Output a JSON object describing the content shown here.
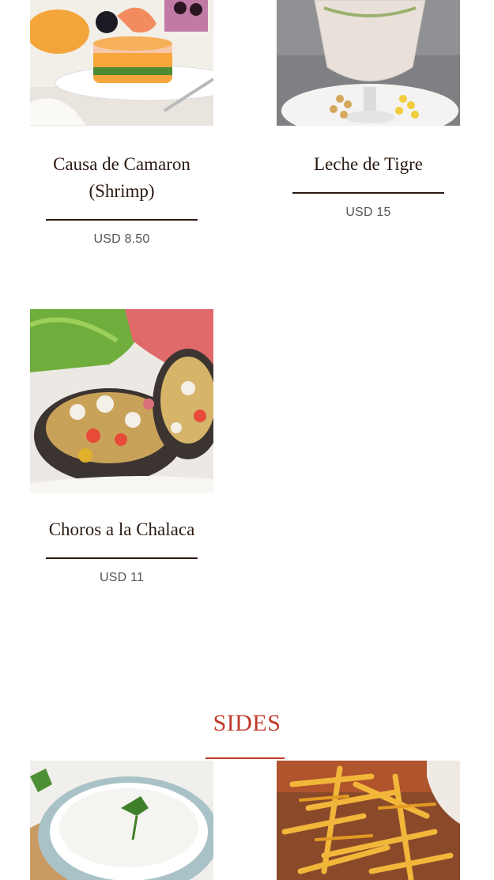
{
  "menu": {
    "items": [
      {
        "name": "Causa de Camaron (Shrimp)",
        "name_line1": "Causa de Camaron",
        "name_line2": "(Shrimp)",
        "price": "USD 8.50",
        "icon": "causa-photo"
      },
      {
        "name": "Leche de Tigre",
        "price": "USD 15",
        "icon": "leche-de-tigre-photo"
      },
      {
        "name": "Choros a la Chalaca",
        "price": "USD 11",
        "icon": "choros-photo"
      }
    ]
  },
  "sides": {
    "title": "SIDES",
    "items": [
      {
        "icon": "white-rice-photo"
      },
      {
        "icon": "french-fries-photo"
      }
    ]
  },
  "colors": {
    "accent": "#c0392b",
    "text": "#2b1a12",
    "price": "#555555"
  }
}
